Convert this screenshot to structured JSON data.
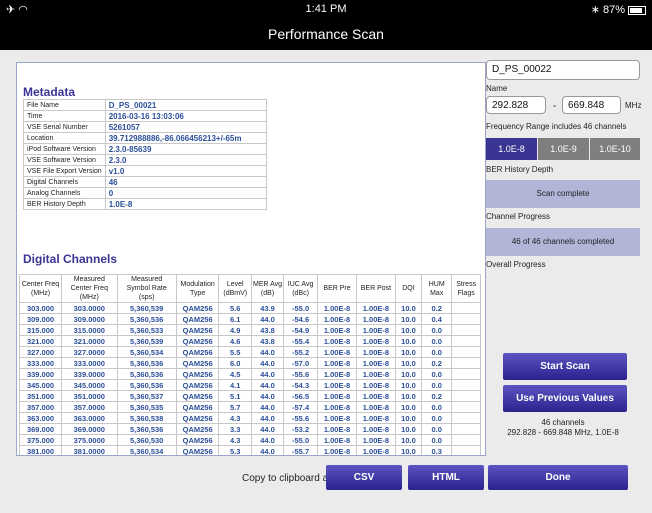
{
  "status": {
    "time": "1:41 PM",
    "battery": "87%",
    "left_icons": "✈ ◠"
  },
  "title": "Performance Scan",
  "metadata": {
    "heading": "Metadata",
    "rows": [
      [
        "File Name",
        "D_PS_00021"
      ],
      [
        "Time",
        "2016-03-16 13:03:06"
      ],
      [
        "VSE Serial Number",
        "5261057"
      ],
      [
        "Location",
        "39.712988886,-86.066456213+/-65m"
      ],
      [
        "iPod Software Version",
        "2.3.0-85639"
      ],
      [
        "VSE Software Version",
        "2.3.0"
      ],
      [
        "VSE File Export Version",
        "v1.0"
      ],
      [
        "Digital Channels",
        "46"
      ],
      [
        "Analog Channels",
        "0"
      ],
      [
        "BER History Depth",
        "1.0E-8"
      ]
    ]
  },
  "digital_channels": {
    "heading": "Digital Channels",
    "columns": [
      "Center Freq (MHz)",
      "Measured Center Freq (MHz)",
      "Measured Symbol Rate (sps)",
      "Modulation Type",
      "Level (dBmV)",
      "MER Avg (dB)",
      "IUC Avg (dBc)",
      "BER Pre",
      "BER Post",
      "DQI",
      "HUM Max",
      "Stress Flags"
    ],
    "rows": [
      [
        "303.000",
        "303.0000",
        "5,360,539",
        "QAM256",
        "5.6",
        "43.9",
        "-55.0",
        "1.00E-8",
        "1.00E-8",
        "10.0",
        "0.2",
        ""
      ],
      [
        "309.000",
        "309.0000",
        "5,360,536",
        "QAM256",
        "6.1",
        "44.0",
        "-54.6",
        "1.00E-8",
        "1.00E-8",
        "10.0",
        "0.4",
        ""
      ],
      [
        "315.000",
        "315.0000",
        "5,360,533",
        "QAM256",
        "4.9",
        "43.8",
        "-54.9",
        "1.00E-8",
        "1.00E-8",
        "10.0",
        "0.0",
        ""
      ],
      [
        "321.000",
        "321.0000",
        "5,360,539",
        "QAM256",
        "4.6",
        "43.8",
        "-55.4",
        "1.00E-8",
        "1.00E-8",
        "10.0",
        "0.0",
        ""
      ],
      [
        "327.000",
        "327.0000",
        "5,360,534",
        "QAM256",
        "5.5",
        "44.0",
        "-55.2",
        "1.00E-8",
        "1.00E-8",
        "10.0",
        "0.0",
        ""
      ],
      [
        "333.000",
        "333.0000",
        "5,360,536",
        "QAM256",
        "6.0",
        "44.0",
        "-57.0",
        "1.00E-8",
        "1.00E-8",
        "10.0",
        "0.2",
        ""
      ],
      [
        "339.000",
        "339.0000",
        "5,360,536",
        "QAM256",
        "4.5",
        "44.0",
        "-55.6",
        "1.00E-8",
        "1.00E-8",
        "10.0",
        "0.0",
        ""
      ],
      [
        "345.000",
        "345.0000",
        "5,360,536",
        "QAM256",
        "4.1",
        "44.0",
        "-54.3",
        "1.00E-8",
        "1.00E-8",
        "10.0",
        "0.0",
        ""
      ],
      [
        "351.000",
        "351.0000",
        "5,360,537",
        "QAM256",
        "5.1",
        "44.0",
        "-56.5",
        "1.00E-8",
        "1.00E-8",
        "10.0",
        "0.2",
        ""
      ],
      [
        "357.000",
        "357.0000",
        "5,360,535",
        "QAM256",
        "5.7",
        "44.0",
        "-57.4",
        "1.00E-8",
        "1.00E-8",
        "10.0",
        "0.0",
        ""
      ],
      [
        "363.000",
        "363.0000",
        "5,360,538",
        "QAM256",
        "4.3",
        "44.0",
        "-55.6",
        "1.00E-8",
        "1.00E-8",
        "10.0",
        "0.0",
        ""
      ],
      [
        "369.000",
        "369.0000",
        "5,360,536",
        "QAM256",
        "3.3",
        "44.0",
        "-53.2",
        "1.00E-8",
        "1.00E-8",
        "10.0",
        "0.0",
        ""
      ],
      [
        "375.000",
        "375.0000",
        "5,360,530",
        "QAM256",
        "4.3",
        "44.0",
        "-55.0",
        "1.00E-8",
        "1.00E-8",
        "10.0",
        "0.0",
        ""
      ],
      [
        "381.000",
        "381.0000",
        "5,360,534",
        "QAM256",
        "5.3",
        "44.0",
        "-55.7",
        "1.00E-8",
        "1.00E-8",
        "10.0",
        "0.3",
        ""
      ]
    ]
  },
  "side": {
    "name_value": "D_PS_00022",
    "name_label": "Name",
    "freq_low": "292.828",
    "freq_sep": "-",
    "freq_high": "669.848",
    "freq_unit": "MHz",
    "freq_label": "Frequency Range includes 46 channels",
    "ber_options": [
      "1.0E-8",
      "1.0E-9",
      "1.0E-10"
    ],
    "ber_label": "BER History Depth",
    "scan_status": "Scan complete",
    "channel_label": "Channel Progress",
    "overall_status": "46 of 46 channels completed",
    "overall_label": "Overall Progress",
    "start_scan": "Start Scan",
    "use_previous": "Use Previous Values",
    "summary_line1": "46 channels",
    "summary_line2": "292.828 - 669.848 MHz, 1.0E-8"
  },
  "bottom": {
    "copy_label": "Copy to clipboard as:",
    "csv": "CSV",
    "html": "HTML",
    "done": "Done"
  },
  "colors": {
    "accent": "#3a3493",
    "selected_seg": "#3a3493",
    "seg": "#7f7f7f",
    "progress": "#b1b5d7",
    "value_text": "#2c4f99"
  }
}
